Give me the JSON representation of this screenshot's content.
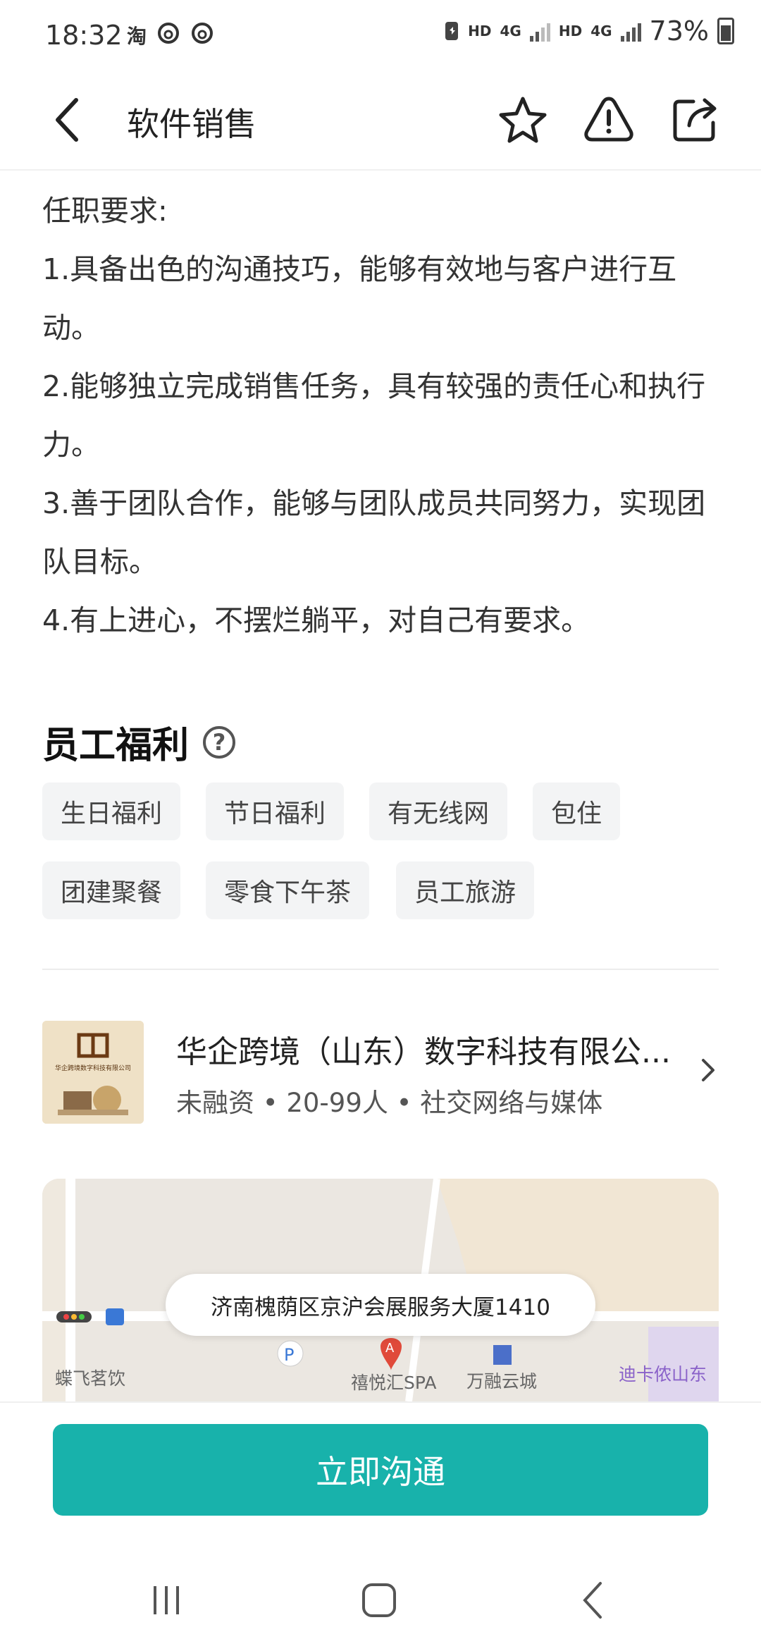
{
  "status_bar": {
    "time": "18:32",
    "left_icons": [
      "淘",
      "netease-icon",
      "netease-icon"
    ],
    "hd1": "HD",
    "net1": "4G",
    "hd2": "HD",
    "net2": "4G",
    "battery": "73%"
  },
  "header": {
    "title": "软件销售",
    "icons": [
      "back-arrow-icon",
      "star-icon",
      "warning-icon",
      "share-icon"
    ]
  },
  "requirements": {
    "heading": "任职要求:",
    "items": [
      "1.具备出色的沟通技巧，能够有效地与客户进行互动。",
      "2.能够独立完成销售任务，具有较强的责任心和执行力。",
      "3.善于团队合作，能够与团队成员共同努力，实现团队目标。",
      "4.有上进心，不摆烂躺平，对自己有要求。"
    ]
  },
  "benefits": {
    "title": "员工福利",
    "help": "?",
    "tags": [
      "生日福利",
      "节日福利",
      "有无线网",
      "包住",
      "团建聚餐",
      "零食下午茶",
      "员工旅游"
    ]
  },
  "company": {
    "name": "华企跨境（山东）数字科技有限公...",
    "info": "未融资 • 20-99人 • 社交网络与媒体",
    "logo_text": "华企跨境数字科技有限公司"
  },
  "map": {
    "address": "济南槐荫区京沪会展服务大厦1410",
    "marker": "A",
    "labels": [
      "蝶飞茗饮",
      "禧悦汇SPA",
      "万融云城",
      "迪卡侬山东"
    ]
  },
  "cta": {
    "label": "立即沟通"
  },
  "colors": {
    "accent": "#18b2ab",
    "tag_bg": "#f3f4f5"
  }
}
